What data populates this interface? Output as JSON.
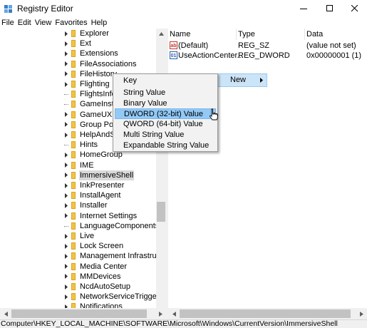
{
  "window": {
    "title": "Registry Editor",
    "minimize_icon": "minimize-icon",
    "maximize_icon": "maximize-icon",
    "close_icon": "close-icon"
  },
  "menubar": [
    "File",
    "Edit",
    "View",
    "Favorites",
    "Help"
  ],
  "tree": {
    "items": [
      {
        "label": "Explorer",
        "expander": true
      },
      {
        "label": "Ext",
        "expander": true
      },
      {
        "label": "Extensions",
        "expander": true
      },
      {
        "label": "FileAssociations",
        "expander": true
      },
      {
        "label": "FileHistory",
        "expander": true
      },
      {
        "label": "Flighting",
        "expander": true
      },
      {
        "label": "FlightsInfo",
        "expander": false
      },
      {
        "label": "GameInsta",
        "expander": false
      },
      {
        "label": "GameUX",
        "expander": true
      },
      {
        "label": "Group Poli",
        "expander": true
      },
      {
        "label": "HelpAndSu",
        "expander": true
      },
      {
        "label": "Hints",
        "expander": false
      },
      {
        "label": "HomeGroup",
        "expander": true
      },
      {
        "label": "IME",
        "expander": true
      },
      {
        "label": "ImmersiveShell",
        "expander": true,
        "selected": true
      },
      {
        "label": "InkPresenter",
        "expander": true
      },
      {
        "label": "InstallAgent",
        "expander": true
      },
      {
        "label": "Installer",
        "expander": true
      },
      {
        "label": "Internet Settings",
        "expander": true
      },
      {
        "label": "LanguageComponentsIns",
        "expander": false
      },
      {
        "label": "Live",
        "expander": true
      },
      {
        "label": "Lock Screen",
        "expander": true
      },
      {
        "label": "Management Infrastructu",
        "expander": true
      },
      {
        "label": "Media Center",
        "expander": true
      },
      {
        "label": "MMDevices",
        "expander": true
      },
      {
        "label": "NcdAutoSetup",
        "expander": true
      },
      {
        "label": "NetworkServiceTriggers",
        "expander": true
      },
      {
        "label": "Notifications",
        "expander": true
      }
    ]
  },
  "values": {
    "headers": {
      "name": "Name",
      "type": "Type",
      "data": "Data"
    },
    "rows": [
      {
        "icon": "string-value-icon",
        "icon_text": "ab",
        "name": "(Default)",
        "type": "REG_SZ",
        "data": "(value not set)"
      },
      {
        "icon": "binary-value-icon",
        "icon_text": "01",
        "name": "UseActionCenter...",
        "type": "REG_DWORD",
        "data": "0x00000001 (1)"
      }
    ]
  },
  "context_menu": {
    "new_label": "New",
    "submenu": [
      {
        "label": "Key"
      },
      {
        "label": "String Value"
      },
      {
        "label": "Binary Value"
      },
      {
        "label": "DWORD (32-bit) Value",
        "highlighted": true
      },
      {
        "label": "QWORD (64-bit) Value"
      },
      {
        "label": "Multi String Value"
      },
      {
        "label": "Expandable String Value"
      }
    ]
  },
  "statusbar": {
    "path": "Computer\\HKEY_LOCAL_MACHINE\\SOFTWARE\\Microsoft\\Windows\\CurrentVersion\\ImmersiveShell"
  },
  "colors": {
    "selected_item_bg": "#d9d9d9",
    "menu_highlight": "#91c9f7",
    "folder": "#f3c443"
  }
}
